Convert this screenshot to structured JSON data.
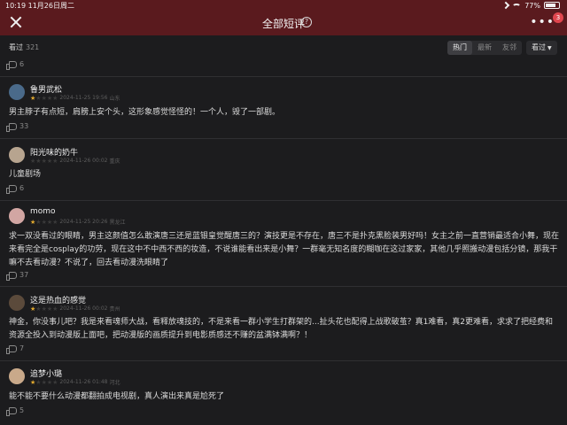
{
  "status_bar": {
    "time": "10:19",
    "date": "11月26日周二",
    "battery": "77%",
    "battery_level": 0.77
  },
  "nav": {
    "title": "全部短评",
    "help_glyph": "?",
    "more_glyph": "•••",
    "badge": "3"
  },
  "filter": {
    "watched_label": "看过",
    "watched_count": "321",
    "tabs": [
      "热门",
      "最新",
      "友邻"
    ],
    "active_tab": "热门",
    "fold_label": "看过"
  },
  "top_likes": "6",
  "reviews": [
    {
      "user": "鲁男武松",
      "rating": 1,
      "date": "2024-11-25 19:56",
      "region": "山东",
      "avatar_color": "#4a6a8a",
      "text": "男主脖子有点短，肩膀上安个头，这形象感觉怪怪的！一个人，毁了一部剧。",
      "likes": "33"
    },
    {
      "user": "阳光味的奶牛",
      "rating": 0,
      "date": "2024-11-26 00:02",
      "region": "重庆",
      "avatar_color": "#b7a48f",
      "text": "儿童剧场",
      "likes": "6"
    },
    {
      "user": "momo",
      "rating": 1,
      "date": "2024-11-25 20:26",
      "region": "黑龙江",
      "avatar_color": "#d2a6a3",
      "text": "求一双没看过的眼睛，男主这颜值怎么敢演唐三还是蓝银皇觉醒唐三的？演技更是不存在，唐三不是扑克黑脸装男好吗！女主之前一直营销最适合小舞，现在来看完全是cosplay的功劳，现在这中不中西不西的妆造，不说谁能看出来是小舞？一群毫无知名度的糊咖在这过家家，其他几乎照搬动漫包括分镜，那我干嘛不去看动漫？不说了，回去看动漫洗眼睛了",
      "likes": "37"
    },
    {
      "user": "这是热血的感觉",
      "rating": 1,
      "date": "2024-11-26 00:02",
      "region": "贵州",
      "avatar_color": "#5b4a3b",
      "text": "神金，你没事儿吧？我是来看魂师大战，看释放魂技的，不是来看一群小学生打群架的...扯头花也配得上战歌破茧？真1难看，真2更难看，求求了把经费和资源全投入到动漫版上面吧，把动漫版的画质提升到电影质感还不赚的盆满钵满啊？！",
      "likes": "7"
    },
    {
      "user": "追梦小璐",
      "rating": 1,
      "date": "2024-11-26 01:48",
      "region": "河北",
      "avatar_color": "#c9a98a",
      "text": "能不能不要什么动漫都翻拍成电视剧，真人演出来真是尬死了",
      "likes": "5"
    }
  ]
}
